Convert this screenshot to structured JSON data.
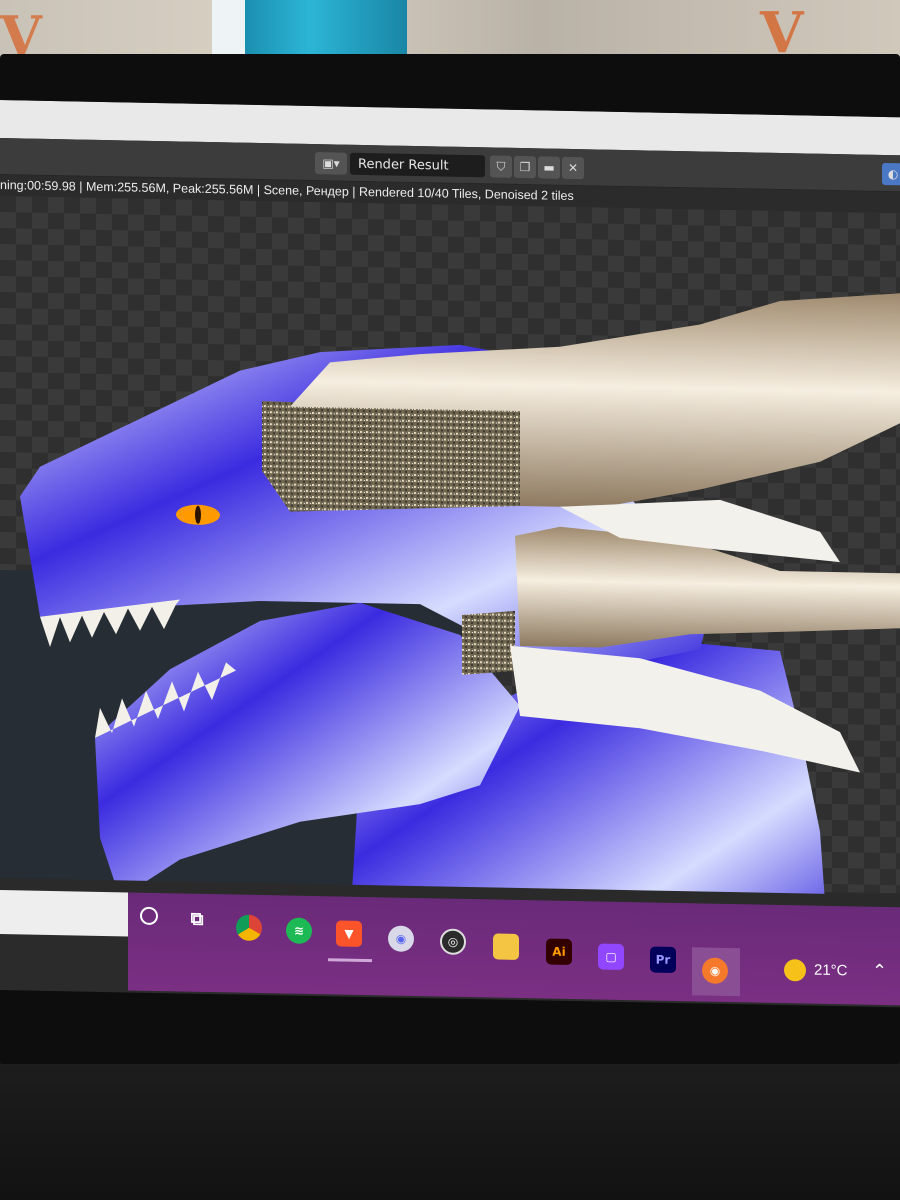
{
  "room": {
    "wall_letter_left": "V",
    "wall_letter_right": "V"
  },
  "image_editor": {
    "image_name": "Render Result",
    "status": "ning:00:59.98 | Mem:255.56M, Peak:255.56M | Scene, Рендер | Rendered 10/40 Tiles, Denoised 2 tiles"
  },
  "taskbar": {
    "apps": [
      "search-icon",
      "task-view-icon",
      "chrome-icon",
      "spotify-icon",
      "brave-icon",
      "discord-icon",
      "obs-icon",
      "file-explorer-icon",
      "illustrator-icon",
      "twitch-icon",
      "premiere-icon",
      "blender-icon"
    ],
    "illustrator_label": "Ai",
    "premiere_label": "Pr",
    "temperature": "21°C"
  },
  "colors": {
    "dragon_blue": "#2a1ad8",
    "horn_beige": "#c8b08e",
    "eye": "#ff9a00",
    "taskbar": "#72307e"
  }
}
